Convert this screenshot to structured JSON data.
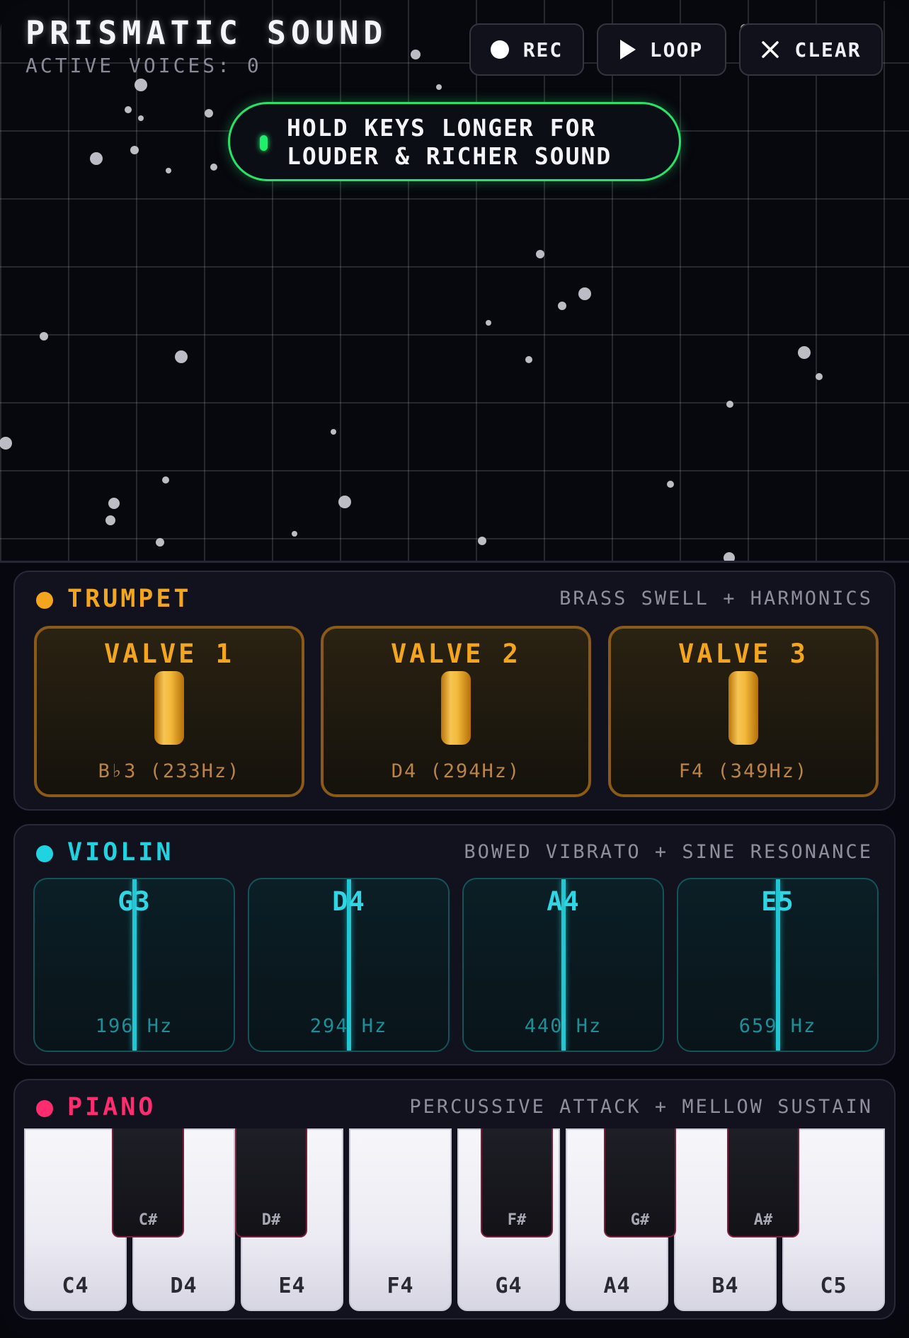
{
  "header": {
    "title": "PRISMATIC SOUND",
    "voices_label": "ACTIVE VOICES:",
    "voices_count": "0"
  },
  "controls": {
    "rec": "REC",
    "loop": "LOOP",
    "clear": "CLEAR"
  },
  "hint": {
    "line1": "HOLD KEYS LONGER FOR",
    "line2": "LOUDER & RICHER SOUND"
  },
  "trumpet": {
    "name": "TRUMPET",
    "description": "BRASS SWELL + HARMONICS",
    "color": "#f4a51e",
    "valves": [
      {
        "label": "VALVE 1",
        "note": "B♭3 (233Hz)"
      },
      {
        "label": "VALVE 2",
        "note": "D4 (294Hz)"
      },
      {
        "label": "VALVE 3",
        "note": "F4 (349Hz)"
      }
    ]
  },
  "violin": {
    "name": "VIOLIN",
    "description": "BOWED VIBRATO + SINE RESONANCE",
    "color": "#1fd3e0",
    "strings": [
      {
        "note": "G3",
        "hz": "196 Hz"
      },
      {
        "note": "D4",
        "hz": "294 Hz"
      },
      {
        "note": "A4",
        "hz": "440 Hz"
      },
      {
        "note": "E5",
        "hz": "659 Hz"
      }
    ]
  },
  "piano": {
    "name": "PIANO",
    "description": "PERCUSSIVE ATTACK + MELLOW SUSTAIN",
    "color": "#ff2d6f",
    "white_keys": [
      "C4",
      "D4",
      "E4",
      "F4",
      "G4",
      "A4",
      "B4",
      "C5"
    ],
    "black_keys": [
      "C#",
      "D#",
      "F#",
      "G#",
      "A#"
    ]
  },
  "icons": {
    "rec": "record-dot-icon",
    "loop": "play-triangle-icon",
    "clear": "close-x-icon"
  }
}
